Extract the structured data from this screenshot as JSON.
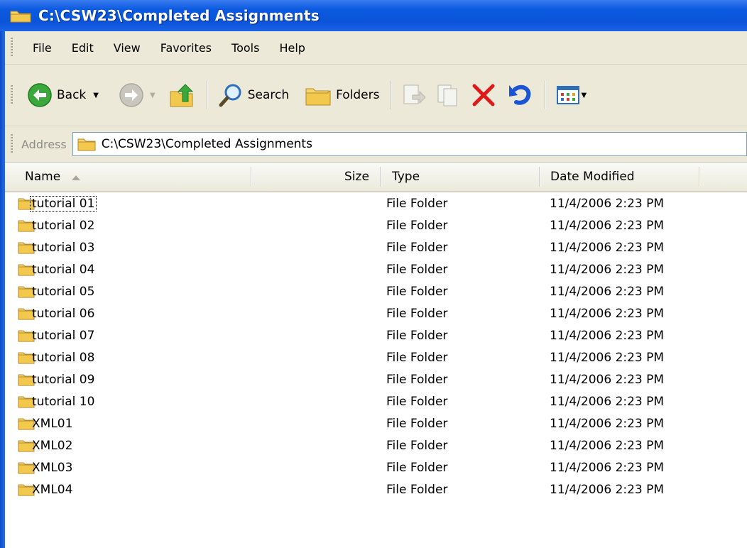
{
  "window": {
    "title": "C:\\CSW23\\Completed Assignments"
  },
  "menu": [
    "File",
    "Edit",
    "View",
    "Favorites",
    "Tools",
    "Help"
  ],
  "toolbar": {
    "back_label": "Back",
    "search_label": "Search",
    "folders_label": "Folders"
  },
  "address": {
    "label": "Address",
    "value": "C:\\CSW23\\Completed Assignments"
  },
  "columns": {
    "name": "Name",
    "size": "Size",
    "type": "Type",
    "date": "Date Modified",
    "sort_icon": "sort-ascending-icon"
  },
  "files": [
    {
      "name": "tutorial 01",
      "type": "File Folder",
      "date": "11/4/2006 2:23 PM"
    },
    {
      "name": "tutorial 02",
      "type": "File Folder",
      "date": "11/4/2006 2:23 PM"
    },
    {
      "name": "tutorial 03",
      "type": "File Folder",
      "date": "11/4/2006 2:23 PM"
    },
    {
      "name": "tutorial 04",
      "type": "File Folder",
      "date": "11/4/2006 2:23 PM"
    },
    {
      "name": "tutorial 05",
      "type": "File Folder",
      "date": "11/4/2006 2:23 PM"
    },
    {
      "name": "tutorial 06",
      "type": "File Folder",
      "date": "11/4/2006 2:23 PM"
    },
    {
      "name": "tutorial 07",
      "type": "File Folder",
      "date": "11/4/2006 2:23 PM"
    },
    {
      "name": "tutorial 08",
      "type": "File Folder",
      "date": "11/4/2006 2:23 PM"
    },
    {
      "name": "tutorial 09",
      "type": "File Folder",
      "date": "11/4/2006 2:23 PM"
    },
    {
      "name": "tutorial 10",
      "type": "File Folder",
      "date": "11/4/2006 2:23 PM"
    },
    {
      "name": "XML01",
      "type": "File Folder",
      "date": "11/4/2006 2:23 PM"
    },
    {
      "name": "XML02",
      "type": "File Folder",
      "date": "11/4/2006 2:23 PM"
    },
    {
      "name": "XML03",
      "type": "File Folder",
      "date": "11/4/2006 2:23 PM"
    },
    {
      "name": "XML04",
      "type": "File Folder",
      "date": "11/4/2006 2:23 PM"
    }
  ],
  "colors": {
    "titlebar": "#0a54d9",
    "chrome": "#ece9d8",
    "folder": "#f2c94c",
    "delete": "#e01818",
    "undo": "#1a55d6"
  }
}
